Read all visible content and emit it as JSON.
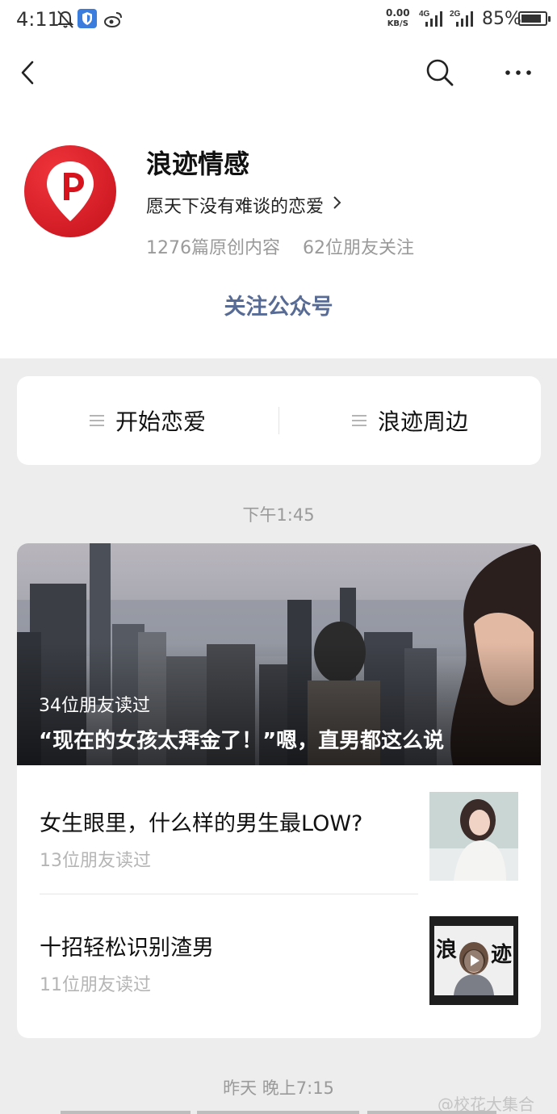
{
  "status_bar": {
    "time": "4:11",
    "speed_value": "0.00",
    "speed_unit": "KB/S",
    "net_a": "4G",
    "net_b": "2G",
    "battery_text": "85%",
    "battery_level": 0.85,
    "icons": [
      "bell-off-icon",
      "shield-app-icon",
      "weibo-icon",
      "signal-icon",
      "battery-icon"
    ]
  },
  "nav": {
    "icons": [
      "back-icon",
      "search-icon",
      "more-icon"
    ]
  },
  "profile": {
    "name": "浪迹情感",
    "description": "愿天下没有难谈的恋爱",
    "stats": [
      "1276篇原创内容",
      "62位朋友关注"
    ],
    "follow_label": "关注公众号",
    "colors": {
      "brand_red": "#d7141d",
      "link_blue": "#576b95"
    }
  },
  "menu": {
    "items": [
      {
        "label": "开始恋爱",
        "icon": "menu-list-icon"
      },
      {
        "label": "浪迹周边",
        "icon": "menu-list-icon"
      }
    ]
  },
  "feed": {
    "groups": [
      {
        "time": "下午1:45",
        "hero": {
          "reads": "34位朋友读过",
          "title": "“现在的女孩太拜金了！”嗯，直男都这么说"
        },
        "items": [
          {
            "title": "女生眼里，什么样的男生最LOW?",
            "reads": "13位朋友读过"
          },
          {
            "title": "十招轻松识别渣男",
            "reads": "11位朋友读过",
            "thumb_text_left": "浪",
            "thumb_text_right": "迹"
          }
        ]
      },
      {
        "time": "昨天 晚上7:15"
      }
    ]
  },
  "watermark": "@校花大集合"
}
